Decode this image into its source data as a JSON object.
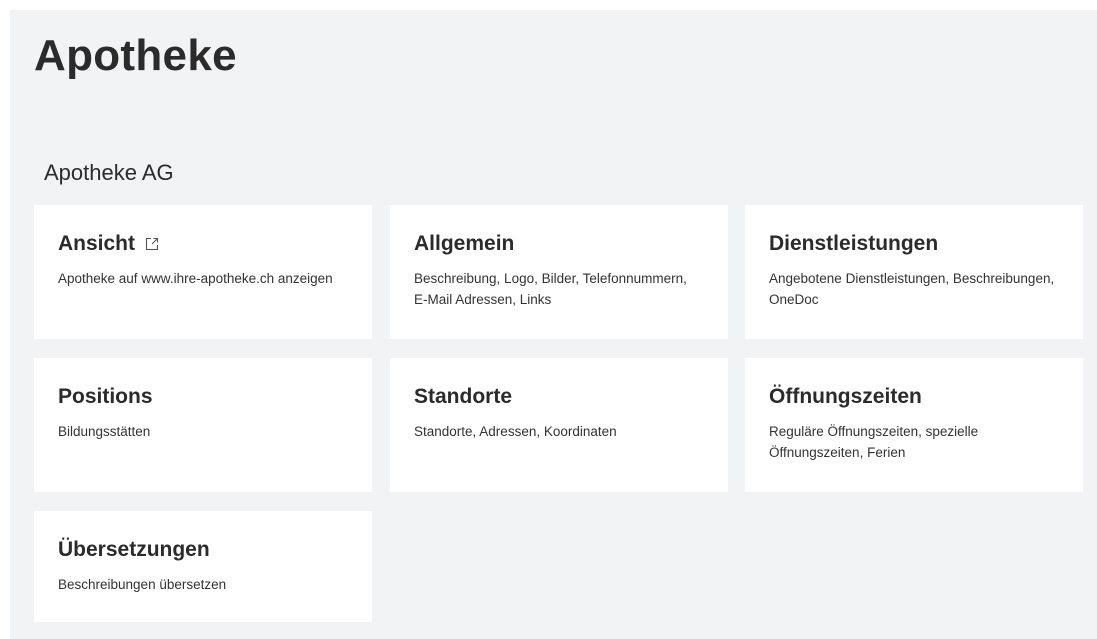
{
  "page": {
    "title": "Apotheke",
    "organization": "Apotheke AG"
  },
  "cards": [
    {
      "title": "Ansicht",
      "description": "Apotheke auf www.ihre-apotheke.ch anzeigen",
      "icon": "external-link-icon"
    },
    {
      "title": "Allgemein",
      "description": "Beschreibung, Logo, Bilder, Telefonnummern, E-Mail Adressen, Links"
    },
    {
      "title": "Dienstleistungen",
      "description": "Angebotene Dienstleistungen, Beschreibungen, OneDoc"
    },
    {
      "title": "Positions",
      "description": "Bildungsstätten"
    },
    {
      "title": "Standorte",
      "description": "Standorte, Adressen, Koordinaten"
    },
    {
      "title": "Öffnungszeiten",
      "description": "Reguläre Öffnungszeiten, spezielle Öffnungszeiten, Ferien"
    },
    {
      "title": "Übersetzungen",
      "description": "Beschreibungen übersetzen"
    }
  ]
}
